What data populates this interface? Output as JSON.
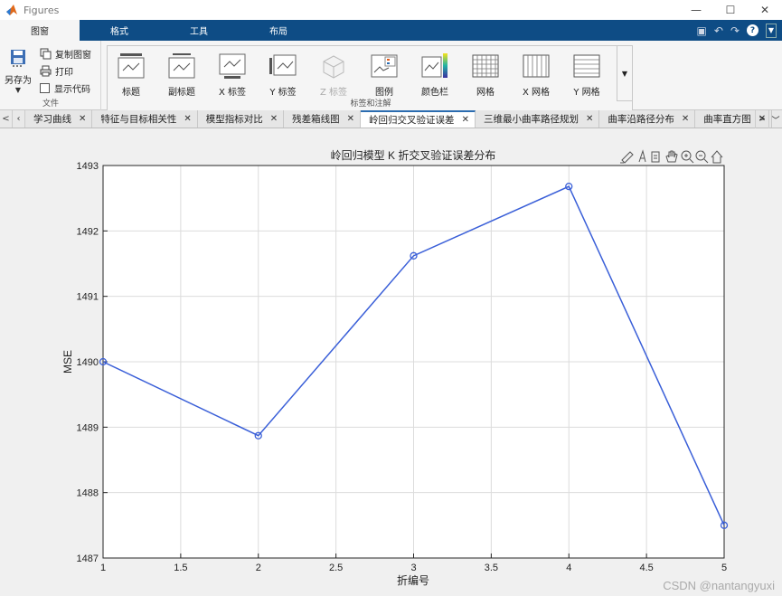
{
  "window": {
    "title": "Figures"
  },
  "ribbon_tabs": [
    "图窗",
    "格式",
    "工具",
    "布局"
  ],
  "file_group": {
    "save_as": "另存为",
    "copy_figure": "复制图窗",
    "print": "打印",
    "show_code": "显示代码",
    "label": "文件"
  },
  "annotation_group": {
    "label": "标签和注解",
    "buttons": [
      "标题",
      "副标题",
      "X 标签",
      "Y 标签",
      "Z 标签",
      "图例",
      "颜色栏",
      "网格",
      "X 网格",
      "Y 网格"
    ]
  },
  "doc_tabs": [
    {
      "label": "学习曲线"
    },
    {
      "label": "特征与目标相关性"
    },
    {
      "label": "模型指标对比"
    },
    {
      "label": "残差箱线图"
    },
    {
      "label": "岭回归交叉验证误差"
    },
    {
      "label": "三维最小曲率路径规划"
    },
    {
      "label": "曲率沿路径分布"
    },
    {
      "label": "曲率直方图"
    }
  ],
  "active_doc_tab": 4,
  "colors": {
    "line": "#3a5fd8",
    "accent": "#0e4c85"
  },
  "chart_data": {
    "type": "line",
    "title": "岭回归模型 K 折交叉验证误差分布",
    "xlabel": "折编号",
    "ylabel": "MSE",
    "x": [
      1,
      2,
      3,
      4,
      5
    ],
    "series": [
      {
        "values": [
          1490.0,
          1488.87,
          1491.62,
          1492.68,
          1487.5
        ]
      }
    ],
    "xlim": [
      1,
      5
    ],
    "ylim": [
      1487,
      1493
    ],
    "xticks": [
      "1",
      "1.5",
      "2",
      "2.5",
      "3",
      "3.5",
      "4",
      "4.5",
      "5"
    ],
    "yticks": [
      "1487",
      "1488",
      "1489",
      "1490",
      "1491",
      "1492",
      "1493"
    ],
    "grid": true,
    "marker": "circle"
  },
  "watermark": "CSDN @nantangyuxi"
}
